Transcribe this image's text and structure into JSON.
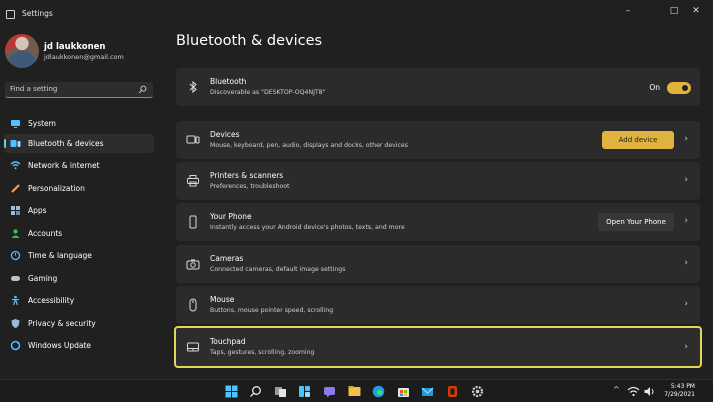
{
  "window": {
    "title": "Settings",
    "minimize": "–",
    "maximize": "□",
    "close": "✕"
  },
  "user": {
    "name": "jd laukkonen",
    "email": "jdlaukkonen@gmail.com"
  },
  "search": {
    "placeholder": "Find a setting"
  },
  "nav": [
    {
      "label": "System",
      "icon": "monitor-icon",
      "color": "#4cc2ff"
    },
    {
      "label": "Bluetooth & devices",
      "icon": "bluetooth-icon",
      "color": "#4cc2ff"
    },
    {
      "label": "Network & internet",
      "icon": "wifi-icon",
      "color": "#4cc2ff"
    },
    {
      "label": "Personalization",
      "icon": "brush-icon",
      "color": "#f7a35c"
    },
    {
      "label": "Apps",
      "icon": "apps-icon",
      "color": "#9fb8d6"
    },
    {
      "label": "Accounts",
      "icon": "person-icon",
      "color": "#3fb950"
    },
    {
      "label": "Time & language",
      "icon": "globe-clock-icon",
      "color": "#4cc2ff"
    },
    {
      "label": "Gaming",
      "icon": "controller-icon",
      "color": "#c0c0c0"
    },
    {
      "label": "Accessibility",
      "icon": "accessibility-icon",
      "color": "#4cc2ff"
    },
    {
      "label": "Privacy & security",
      "icon": "shield-icon",
      "color": "#9fb8d6"
    },
    {
      "label": "Windows Update",
      "icon": "update-icon",
      "color": "#4cc2ff"
    }
  ],
  "page": {
    "title": "Bluetooth & devices"
  },
  "cards": {
    "bluetooth": {
      "title": "Bluetooth",
      "subtitle": "Discoverable as \"DESKTOP-OQ4NJT8\"",
      "toggle_label": "On"
    },
    "devices": {
      "title": "Devices",
      "subtitle": "Mouse, keyboard, pen, audio, displays and docks, other devices",
      "button": "Add device"
    },
    "printers": {
      "title": "Printers & scanners",
      "subtitle": "Preferences, troubleshoot"
    },
    "phone": {
      "title": "Your Phone",
      "subtitle": "Instantly access your Android device's photos, texts, and more",
      "button": "Open Your Phone"
    },
    "cameras": {
      "title": "Cameras",
      "subtitle": "Connected cameras, default image settings"
    },
    "mouse": {
      "title": "Mouse",
      "subtitle": "Buttons, mouse pointer speed, scrolling"
    },
    "touchpad": {
      "title": "Touchpad",
      "subtitle": "Taps, gestures, scrolling, zooming"
    }
  },
  "taskbar": {
    "tray_chevron": "^",
    "time": "5:43 PM",
    "date": "7/29/2021"
  },
  "colors": {
    "accent": "#e0b33f",
    "highlight_border": "#e2d65a",
    "background": "#202020",
    "card": "#2b2b2b"
  }
}
